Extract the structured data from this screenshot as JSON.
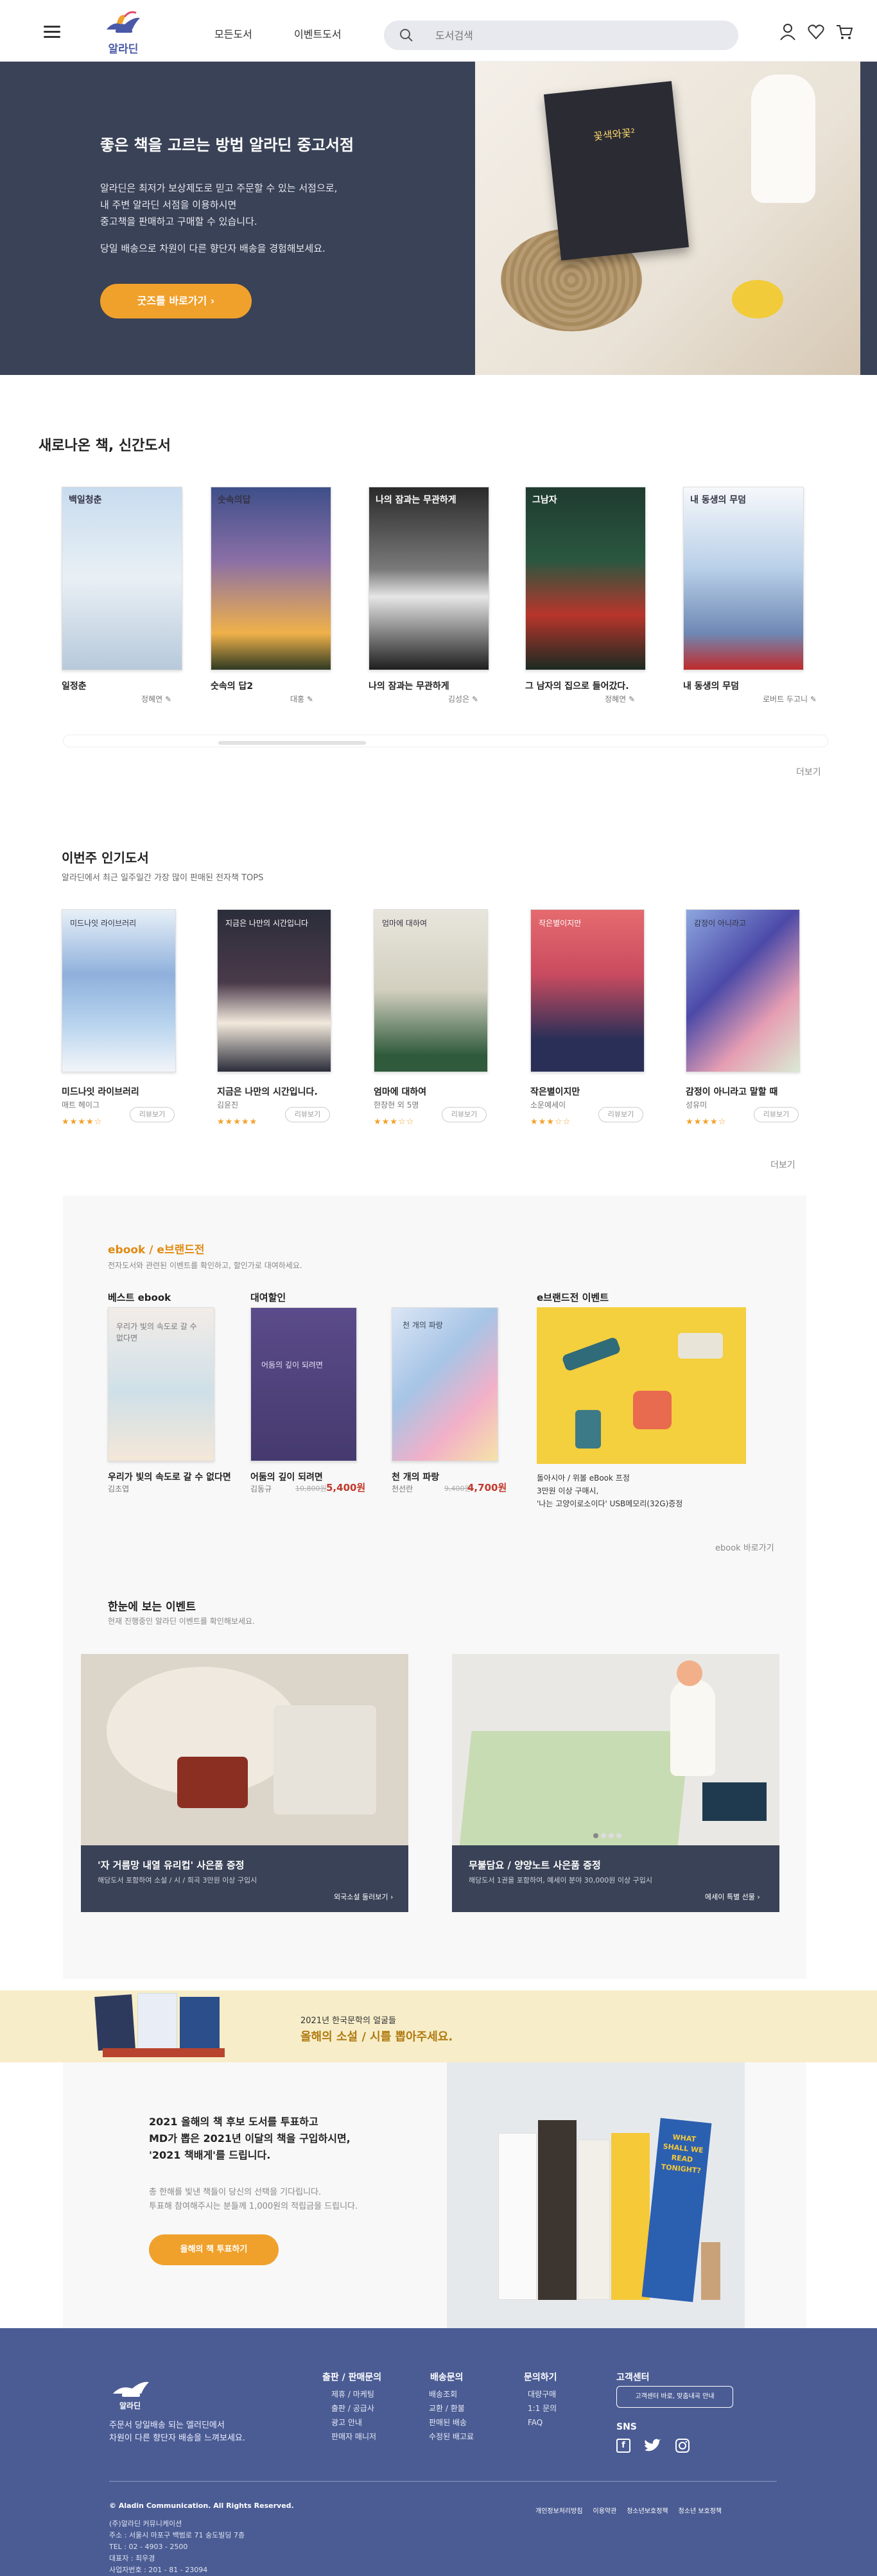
{
  "header": {
    "logo_label": "알라딘",
    "nav": [
      "모든도서",
      "이벤트도서"
    ],
    "search_placeholder": "도서검색"
  },
  "hero": {
    "title": "좋은 책을 고르는 방법 알라딘 중고서점",
    "desc1": "알라딘은 최저가 보상제도로 믿고 주문할 수 있는 서점으로,",
    "desc2": "내 주변 알라딘 서점을 이용하시면",
    "desc3": "중고책을 판매하고 구매할 수 있습니다.",
    "desc4": "당일 배송으로 차원이 다른 향단자 배송을 경험해보세요.",
    "cta": "굿즈를 바로가기",
    "book_cover": "꽃색와꽃²"
  },
  "new_books": {
    "title": "새로나온 책, 신간도서",
    "more": "더보기",
    "items": [
      {
        "title": "일정춘",
        "author": "정혜연",
        "cover": "백일청춘"
      },
      {
        "title": "숫속의 답2",
        "author": "대홍",
        "cover": "숫속의답"
      },
      {
        "title": "나의 잠과는 무관하게",
        "author": "김성은",
        "cover": "나의 잠과는 무관하게"
      },
      {
        "title": "그 남자의 집으로 들어갔다.",
        "author": "정혜연",
        "cover": "그남자"
      },
      {
        "title": "내 동생의 무덤",
        "author": "로버트 두고니",
        "cover": "내 동생의 무덤"
      }
    ]
  },
  "popular": {
    "title": "이번주 인기도서",
    "subtitle": "알라딘에서 최근 일주일간 가장 많이 판매된 전자책 TOPS",
    "more": "더보기",
    "review_label": "리뷰보기",
    "items": [
      {
        "title": "미드나잇 라이브러리",
        "author": "매트 헤이그",
        "stars": "★★★★☆",
        "cover": "미드나잇 라이브러리"
      },
      {
        "title": "지금은 나만의 시간입니다.",
        "author": "김윤진",
        "stars": "★★★★★",
        "cover": "지금은 나만의 시간입니다"
      },
      {
        "title": "엄마에 대하여",
        "author": "한창현 외 5명",
        "stars": "★★★☆☆",
        "cover": "엄마에 대하여"
      },
      {
        "title": "작은별이지만",
        "author": "소운예세이",
        "stars": "★★★☆☆",
        "cover": "작은별이지만"
      },
      {
        "title": "감정이 아니라고 말할 때",
        "author": "성유미",
        "stars": "★★★★☆",
        "cover": "감정이 아니라고"
      }
    ]
  },
  "ebook": {
    "title": "ebook / e브랜드전",
    "subtitle": "전자도서와 관련된 이벤트를 확인하고, 할인가로 대여하세요.",
    "best_label": "베스트 ebook",
    "rent_label": "대여할인",
    "brand_label": "e브랜드전 이벤트",
    "more": "ebook 바로가기",
    "best": {
      "title": "우리가 빛의 속도로 갈 수 없다면",
      "author": "김초엽",
      "cover": "우리가 빛의 속도로 갈 수 없다면"
    },
    "rent": [
      {
        "title": "어둠의 깊이 되려면",
        "author": "김동규",
        "old": "10,800원",
        "price": "5,400원",
        "cover": "어둠의 깊이 되려면"
      },
      {
        "title": "천 개의 파랑",
        "author": "천선란",
        "old": "9,400원",
        "price": "4,700원",
        "cover": "천 개의 파랑"
      }
    ],
    "brand_desc1": "돌아시아 / 위볼 eBook 프정",
    "brand_desc2": "3만원 이상 구매시,",
    "brand_desc3": "'나는 고양이로소이다' USB메모리(32G)증정"
  },
  "events": {
    "title": "한눈에 보는 이벤트",
    "subtitle": "현재 진행중인 알라딘 이벤트를 확인해보세요.",
    "cards": [
      {
        "title": "'자 거름망 내열 유리컵' 사은품 증정",
        "desc": "해당도서 포함하여 소설 / 시 / 희곡 3만원 이상 구입시",
        "link": "외국소설 둘러보기"
      },
      {
        "title": "무불담요 / 양양노트 사은품 증정",
        "desc": "해당도서 1권을 포함하여, 예세이 분야 30,000원 이상 구입시",
        "link": "에세이 특별 선물"
      }
    ]
  },
  "promo": {
    "line1": "2021년 한국문학의 얼굴들",
    "line2": "올해의 소설 / 시를 뽑아주세요."
  },
  "vote": {
    "line1": "2021 올해의 책 후보 도서를 투표하고",
    "line2": "MD가 뽑은 2021년 이달의 책을 구입하시면,",
    "line3": "'2021 책배게'를 드립니다.",
    "line4": "총 한해를 빛낸 책들이 당신의 선택을 기다립니다.",
    "line5": "투표해 참여해주시는 분들께 1,000원의 적립금을 드립니다.",
    "cta": "올해의 책 투표하기",
    "book_text": "WHAT SHALL WE READ TONIGHT?"
  },
  "footer": {
    "logo": "알라딘",
    "tagline1": "주문서 당일배송 되는 엘러딘에서",
    "tagline2": "차원이 다른 향단자 배송을 느껴보세요.",
    "cols": [
      {
        "title": "출판 / 판매문의",
        "items": [
          "제휴 / 마케팅",
          "출판 / 공급사",
          "광고 안내",
          "판매자 매니저"
        ]
      },
      {
        "title": "배송문의",
        "items": [
          "배송조회",
          "교환 / 환불",
          "판매된 배송",
          "수정된 배고료"
        ]
      },
      {
        "title": "문의하기",
        "items": [
          "대량구매",
          "1:1 문의",
          "FAQ"
        ]
      },
      {
        "title": "고객센터",
        "items": [
          "고객센터 바로, 맞춤내곡 안내"
        ]
      }
    ],
    "sns": "SNS",
    "copyright": "© Aladin Communication. All Rights Reserved.",
    "address1": "(주)알라딘 커뮤니케이션",
    "address2": "주소 : 서울시 마포구 백범로 71 숭도빌딩 7층",
    "address3": "TEL : 02 - 4903 - 2500",
    "address4": "대표자 : 최우경",
    "address5": "사업자번호 : 201 - 81 - 23094",
    "links": [
      "개인정보처리방침",
      "이용약관",
      "청소년보호정책",
      "청소년 보호정책"
    ]
  }
}
